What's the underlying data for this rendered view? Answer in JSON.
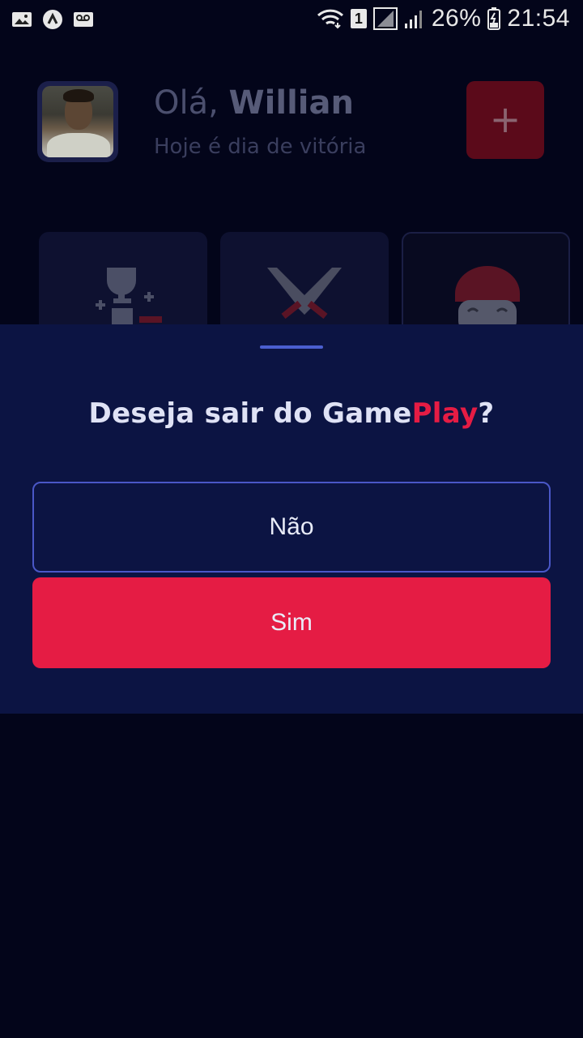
{
  "status_bar": {
    "sim_slot": "1",
    "battery": "26%",
    "time": "21:54",
    "icons_left": [
      "gallery-icon",
      "app-icon",
      "voicemail-icon"
    ],
    "icons_right": [
      "wifi-icon",
      "sim-badge",
      "signal-empty-icon",
      "signal-icon",
      "battery-icon"
    ]
  },
  "home": {
    "greeting_prefix": "Olá,",
    "user_name": "Willian",
    "subtitle": "Hoje é dia de vitória",
    "add_button_label": "+",
    "categories": [
      "trophy-icon",
      "swords-icon",
      "character-icon"
    ]
  },
  "sheet": {
    "title_prefix": "Deseja sair do Game",
    "title_accent": "Play",
    "title_suffix": "?",
    "no_label": "Não",
    "yes_label": "Sim"
  },
  "colors": {
    "background": "#03051a",
    "sheet": "#0c1443",
    "accent": "#e51c44",
    "outline": "#4a57c7"
  }
}
